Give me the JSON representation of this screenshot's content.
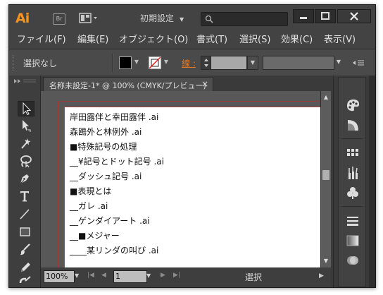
{
  "app": {
    "logo": "Ai",
    "bridge": "Br",
    "workspace": "初期設定",
    "search_placeholder": ""
  },
  "menu": [
    "ファイル(F)",
    "編集(E)",
    "オブジェクト(O)",
    "書式(T)",
    "選択(S)",
    "効果(C)",
    "表示(V)"
  ],
  "control": {
    "selection_label": "選択なし",
    "stroke_label": "線 :"
  },
  "document": {
    "tab_title": "名称未設定-1* @ 100% (CMYK/プレビュー)",
    "close": "×"
  },
  "layers": [
    "岸田露伴と幸田露伴 .ai",
    "森鴎外と林例外 .ai",
    "■特殊記号の処理",
    "__¥記号とドット記号 .ai",
    "__ダッシュ記号 .ai",
    "■表現とは",
    "__ガレ .ai",
    "__ゲンダイアート .ai",
    "__■メジャー",
    "____某リンダの叫び .ai"
  ],
  "status": {
    "zoom": "100%",
    "page": "1",
    "mode": "選択"
  },
  "colors": {
    "accent": "#f7941d",
    "artboard_border": "#9c3b3b",
    "stroke_label": "#e07a2c"
  },
  "icons": {
    "tools": [
      "selection-tool-icon",
      "direct-selection-tool-icon",
      "magic-wand-tool-icon",
      "lasso-tool-icon",
      "pen-tool-icon",
      "type-tool-icon",
      "line-tool-icon",
      "rectangle-tool-icon",
      "paintbrush-tool-icon",
      "pencil-tool-icon",
      "blob-brush-tool-icon"
    ],
    "panels": [
      "color-panel-icon",
      "color-guide-icon",
      "swatches-panel-icon",
      "brushes-panel-icon",
      "symbols-panel-icon",
      "stroke-panel-icon",
      "gradient-panel-icon",
      "transparency-panel-icon"
    ]
  }
}
